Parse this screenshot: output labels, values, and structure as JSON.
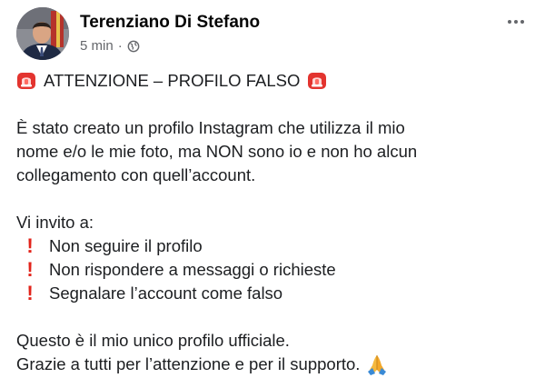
{
  "author": {
    "name": "Terenziano Di Stefano",
    "time": "5 min",
    "separator": "·",
    "privacy_icon": "globe-icon"
  },
  "header_menu_icon": "more-horizontal-icon",
  "post": {
    "title": "ATTENZIONE – PROFILO FALSO",
    "title_icons": [
      "siren-emoji",
      "siren-emoji"
    ],
    "paragraph1": [
      "È stato creato un profilo Instagram che utilizza il mio",
      "nome e/o le mie foto, ma NON sono io e non ho alcun",
      "collegamento con quell’account."
    ],
    "invite_intro": "Vi invito a:",
    "bullet_icon": "red-exclamation-emoji",
    "bullets": [
      "Non seguire il profilo",
      "Non rispondere a messaggi o richieste",
      "Segnalare l’account come falso"
    ],
    "closing": [
      "Questo è il mio unico profilo ufficiale.",
      "Grazie a tutti per l’attenzione e per il supporto."
    ],
    "closing_icon": "folded-hands-emoji"
  },
  "colors": {
    "text": "#1c1e21",
    "meta": "#65676b",
    "alert_red": "#e2231a"
  }
}
